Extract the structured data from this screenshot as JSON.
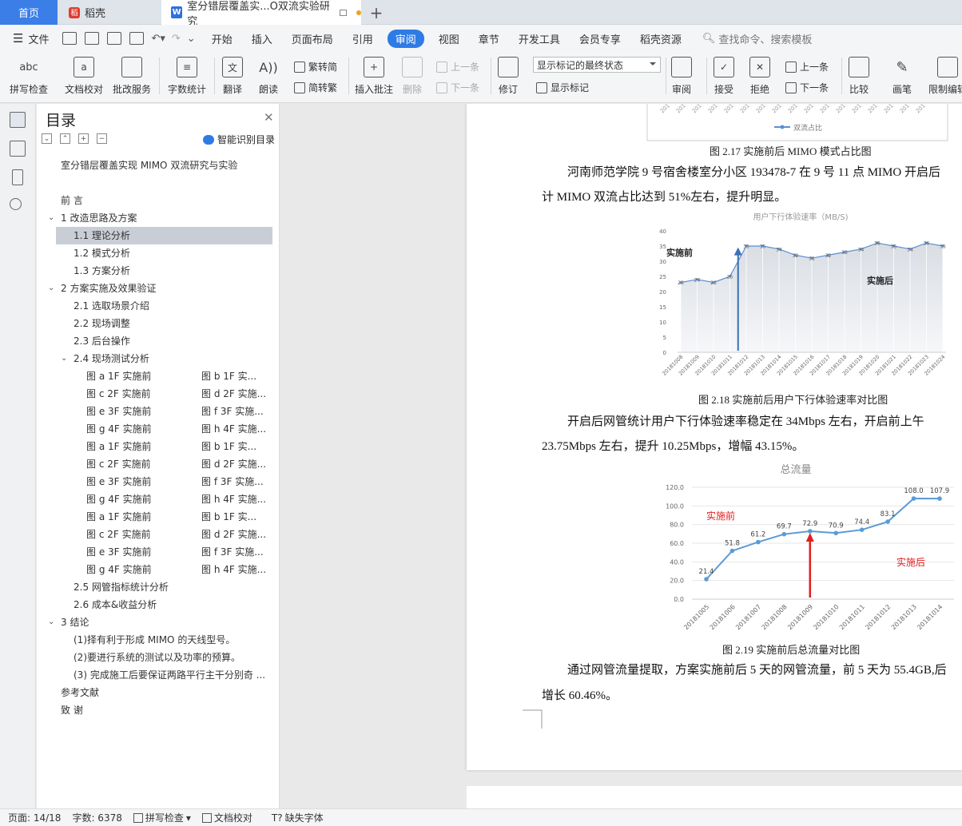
{
  "tabs": {
    "home": "首页",
    "daoke": "稻壳",
    "doc": "室分错层覆盖实...O双流实验研究"
  },
  "menu": {
    "file": "文件",
    "items": [
      "开始",
      "插入",
      "页面布局",
      "引用",
      "审阅",
      "视图",
      "章节",
      "开发工具",
      "会员专享",
      "稻壳资源"
    ],
    "active": "审阅",
    "search": "查找命令、搜索模板"
  },
  "ribbon": {
    "spell": "拼写检查",
    "doc_check": "文档校对",
    "batch": "批改服务",
    "word_count": "字数统计",
    "translate": "翻译",
    "read": "朗读",
    "t2s": "繁转简",
    "s2t": "简转繁",
    "insert_comment": "插入批注",
    "delete": "删除",
    "prev": "上一条",
    "next": "下一条",
    "track": "修订",
    "show_state": "显示标记的最终状态",
    "show_marks": "显示标记",
    "review": "审阅",
    "accept": "接受",
    "reject": "拒绝",
    "prev2": "上一条",
    "next2": "下一条",
    "compare": "比较",
    "pen": "画笔",
    "restrict": "限制编辑"
  },
  "nav": {
    "title": "目录",
    "smart": "智能识别目录",
    "items": [
      {
        "text": "室分错层覆盖实现 MIMO 双流研究与实验",
        "indent": 30,
        "r": ""
      },
      {
        "text": "",
        "indent": 0,
        "r": ""
      },
      {
        "text": "前  言",
        "indent": 30,
        "r": ""
      },
      {
        "text": "1   改造思路及方案",
        "indent": 30,
        "r": "",
        "exp": true
      },
      {
        "text": "1.1   理论分析",
        "indent": 46,
        "r": "",
        "sel": true
      },
      {
        "text": "1.2   模式分析",
        "indent": 46,
        "r": ""
      },
      {
        "text": "1.3   方案分析",
        "indent": 46,
        "r": ""
      },
      {
        "text": "2   方案实施及效果验证",
        "indent": 30,
        "r": "",
        "exp": true
      },
      {
        "text": "2.1   选取场景介绍",
        "indent": 46,
        "r": ""
      },
      {
        "text": "2.2   现场调整",
        "indent": 46,
        "r": ""
      },
      {
        "text": "2.3   后台操作",
        "indent": 46,
        "r": ""
      },
      {
        "text": "2.4   现场测试分析",
        "indent": 46,
        "r": "",
        "exp": true
      },
      {
        "text": "图 a 1F 实施前",
        "indent": 62,
        "r": "图 b 1F 实..."
      },
      {
        "text": "图 c 2F 实施前",
        "indent": 62,
        "r": "图 d 2F 实施..."
      },
      {
        "text": "图 e 3F 实施前",
        "indent": 62,
        "r": "图 f 3F 实施..."
      },
      {
        "text": "图 g 4F 实施前",
        "indent": 62,
        "r": "图 h 4F 实施..."
      },
      {
        "text": "图 a 1F 实施前",
        "indent": 62,
        "r": "图 b 1F 实..."
      },
      {
        "text": "图 c 2F 实施前",
        "indent": 62,
        "r": "图 d 2F 实施..."
      },
      {
        "text": "图 e 3F 实施前",
        "indent": 62,
        "r": "图 f 3F 实施..."
      },
      {
        "text": "图 g 4F 实施前",
        "indent": 62,
        "r": "图 h 4F 实施..."
      },
      {
        "text": "图 a 1F 实施前",
        "indent": 62,
        "r": "图 b 1F 实..."
      },
      {
        "text": "图 c 2F 实施前",
        "indent": 62,
        "r": "图 d 2F 实施..."
      },
      {
        "text": "图 e 3F 实施前",
        "indent": 62,
        "r": "图 f 3F 实施..."
      },
      {
        "text": "图 g 4F 实施前",
        "indent": 62,
        "r": "图 h 4F 实施..."
      },
      {
        "text": "2.5   网管指标统计分析",
        "indent": 46,
        "r": ""
      },
      {
        "text": "2.6   成本&收益分析",
        "indent": 46,
        "r": ""
      },
      {
        "text": "3   结论",
        "indent": 30,
        "r": "",
        "exp": true
      },
      {
        "text": "(1)择有利于形成 MIMO 的天线型号。",
        "indent": 46,
        "r": ""
      },
      {
        "text": "(2)要进行系统的测试以及功率的预算。",
        "indent": 46,
        "r": ""
      },
      {
        "text": "(3)  完成施工后要保证两路平行主干分别奇 ...",
        "indent": 46,
        "r": ""
      },
      {
        "text": "参考文献",
        "indent": 30,
        "r": ""
      },
      {
        "text": "致    谢",
        "indent": 30,
        "r": ""
      }
    ]
  },
  "doc": {
    "legend_top": "双流占比",
    "cap17": "图 2.17 实施前后 MIMO 模式占比图",
    "p1a": "河南师范学院 9 号宿舍楼室分小区 193478-7 在 9 号 11 点 MIMO 开启后",
    "p1b": "计 MIMO 双流占比达到 51%左右，提升明显。",
    "cap18": "图 2.18 实施前后用户下行体验速率对比图",
    "p2a": "开启后网管统计用户下行体验速率稳定在 34Mbps 左右，开启前上午",
    "p2b": "23.75Mbps 左右，提升 10.25Mbps，增幅 43.15%。",
    "cap19": "图 2.19 实施前后总流量对比图",
    "p3a": "通过网管流量提取，方案实施前后 5 天的网管流量，前 5 天为 55.4GB,后",
    "p3b": "增长 60.46%。"
  },
  "chart_data": [
    {
      "type": "area",
      "title": "用户下行体验速率（MB/S)",
      "categories": [
        "20181008",
        "20181009",
        "20181010",
        "20181011",
        "20181012",
        "20181013",
        "20181014",
        "20181015",
        "20181016",
        "20181017",
        "20181018",
        "20181019",
        "20181020",
        "20181021",
        "20181022",
        "20181023",
        "20181024"
      ],
      "values": [
        23,
        24,
        23,
        25,
        35,
        35,
        34,
        32,
        31,
        32,
        33,
        34,
        36,
        35,
        34,
        36,
        35
      ],
      "ylim": [
        0,
        40
      ],
      "yticks": [
        0,
        5,
        10,
        15,
        20,
        25,
        30,
        35,
        40
      ],
      "annotations": [
        "实施前",
        "实施后"
      ],
      "color": "#5b8fd0"
    },
    {
      "type": "line",
      "title": "总流量",
      "categories": [
        "20181005",
        "20181006",
        "20181007",
        "20181008",
        "20181009",
        "20181010",
        "20181011",
        "20181012",
        "20181013",
        "20181014"
      ],
      "values": [
        21.4,
        51.8,
        61.2,
        69.7,
        72.9,
        70.9,
        74.4,
        83.1,
        108.0,
        107.9
      ],
      "labels": [
        "21.4",
        "51.8",
        "61.2",
        "69.7",
        "72.9",
        "70.9",
        "74.4",
        "83.1",
        "108.0",
        "107.9"
      ],
      "ylim": [
        0,
        120
      ],
      "yticks": [
        "0.0",
        "20.0",
        "40.0",
        "60.0",
        "80.0",
        "100.0",
        "120.0"
      ],
      "annotations": [
        "实施前",
        "实施后"
      ],
      "color": "#5b9bd5",
      "marker_color": "#e02020"
    }
  ],
  "status": {
    "page": "页面: 14/18",
    "words": "字数: 6378",
    "spell": "拼写检查",
    "check": "文档校对",
    "font": "缺失字体"
  }
}
